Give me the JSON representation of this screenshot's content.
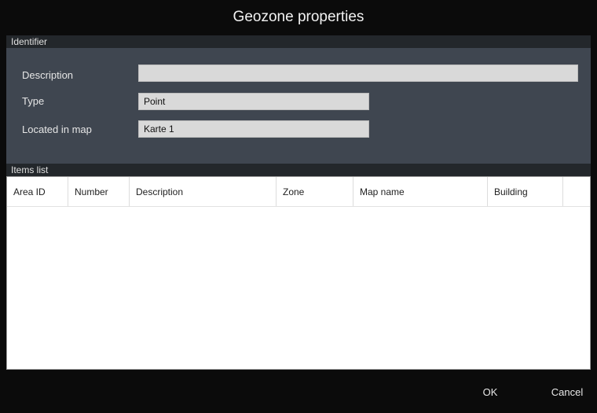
{
  "window": {
    "title": "Geozone properties"
  },
  "identifier": {
    "header": "Identifier",
    "description_label": "Description",
    "description_value": "",
    "type_label": "Type",
    "type_value": "Point",
    "located_label": "Located in map",
    "located_value": "Karte 1"
  },
  "items": {
    "header": "Items list",
    "columns": [
      "Area ID",
      "Number",
      "Description",
      "Zone",
      "Map name",
      "Building",
      ""
    ],
    "rows": []
  },
  "footer": {
    "ok_label": "OK",
    "cancel_label": "Cancel"
  }
}
